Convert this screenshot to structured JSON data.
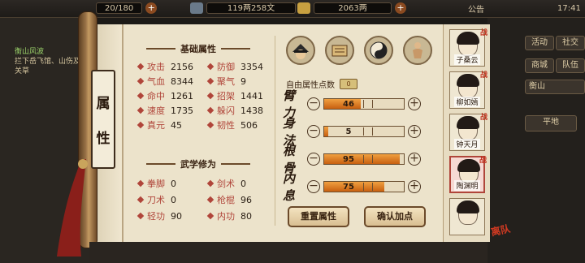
{
  "topbar": {
    "stamina": "20/180",
    "silver": "119两258文",
    "gold": "2063两",
    "notice_label": "公告",
    "time": "17:41"
  },
  "quest": {
    "title": "衡山风波",
    "desc": "拦下岳飞馆、山伤及关草"
  },
  "side_buttons": {
    "activity": "活动",
    "social": "社交",
    "shop": "商城",
    "team": "队伍",
    "location": "衡山",
    "map_label": "平地"
  },
  "page": {
    "title_char1": "属",
    "title_char2": "性"
  },
  "basic": {
    "section_title": "基础属性",
    "left": [
      {
        "label": "攻击",
        "value": "2156"
      },
      {
        "label": "气血",
        "value": "8344"
      },
      {
        "label": "命中",
        "value": "1261"
      },
      {
        "label": "速度",
        "value": "1735"
      },
      {
        "label": "真元",
        "value": "45"
      }
    ],
    "right": [
      {
        "label": "防御",
        "value": "3354"
      },
      {
        "label": "聚气",
        "value": "9"
      },
      {
        "label": "招架",
        "value": "1441"
      },
      {
        "label": "躲闪",
        "value": "1438"
      },
      {
        "label": "韧性",
        "value": "506"
      }
    ]
  },
  "martial": {
    "section_title": "武学修为",
    "left": [
      {
        "label": "拳脚",
        "value": "0"
      },
      {
        "label": "刀术",
        "value": "0"
      },
      {
        "label": "轻功",
        "value": "90"
      }
    ],
    "right": [
      {
        "label": "剑术",
        "value": "0"
      },
      {
        "label": "枪棍",
        "value": "96"
      },
      {
        "label": "内功",
        "value": "80"
      }
    ]
  },
  "skill_icons": [
    "hat-warrior-icon",
    "scroll-book-icon",
    "yin-yang-icon",
    "muscle-figure-icon"
  ],
  "allocation": {
    "free_points_label": "自由属性点数",
    "free_points_value": "0",
    "rows": [
      {
        "label": "臂力",
        "value": "46",
        "fill": 0.46
      },
      {
        "label": "身法",
        "value": "5",
        "fill": 0.05
      },
      {
        "label": "根骨",
        "value": "95",
        "fill": 0.95
      },
      {
        "label": "内息",
        "value": "75",
        "fill": 0.75
      }
    ],
    "reset_button": "重置属性",
    "confirm_button": "确认加点"
  },
  "roster": {
    "members": [
      {
        "name": "子桑云",
        "tag": "战"
      },
      {
        "name": "柳如嫣",
        "tag": "战"
      },
      {
        "name": "钟天月",
        "tag": "战"
      },
      {
        "name": "陶渊明",
        "tag": "战"
      },
      {
        "name": "",
        "tag": ""
      }
    ],
    "stamp": "离队"
  },
  "colors": {
    "accent": "#b0453a",
    "bar": "#e07a20",
    "paper": "#ece3cb"
  }
}
